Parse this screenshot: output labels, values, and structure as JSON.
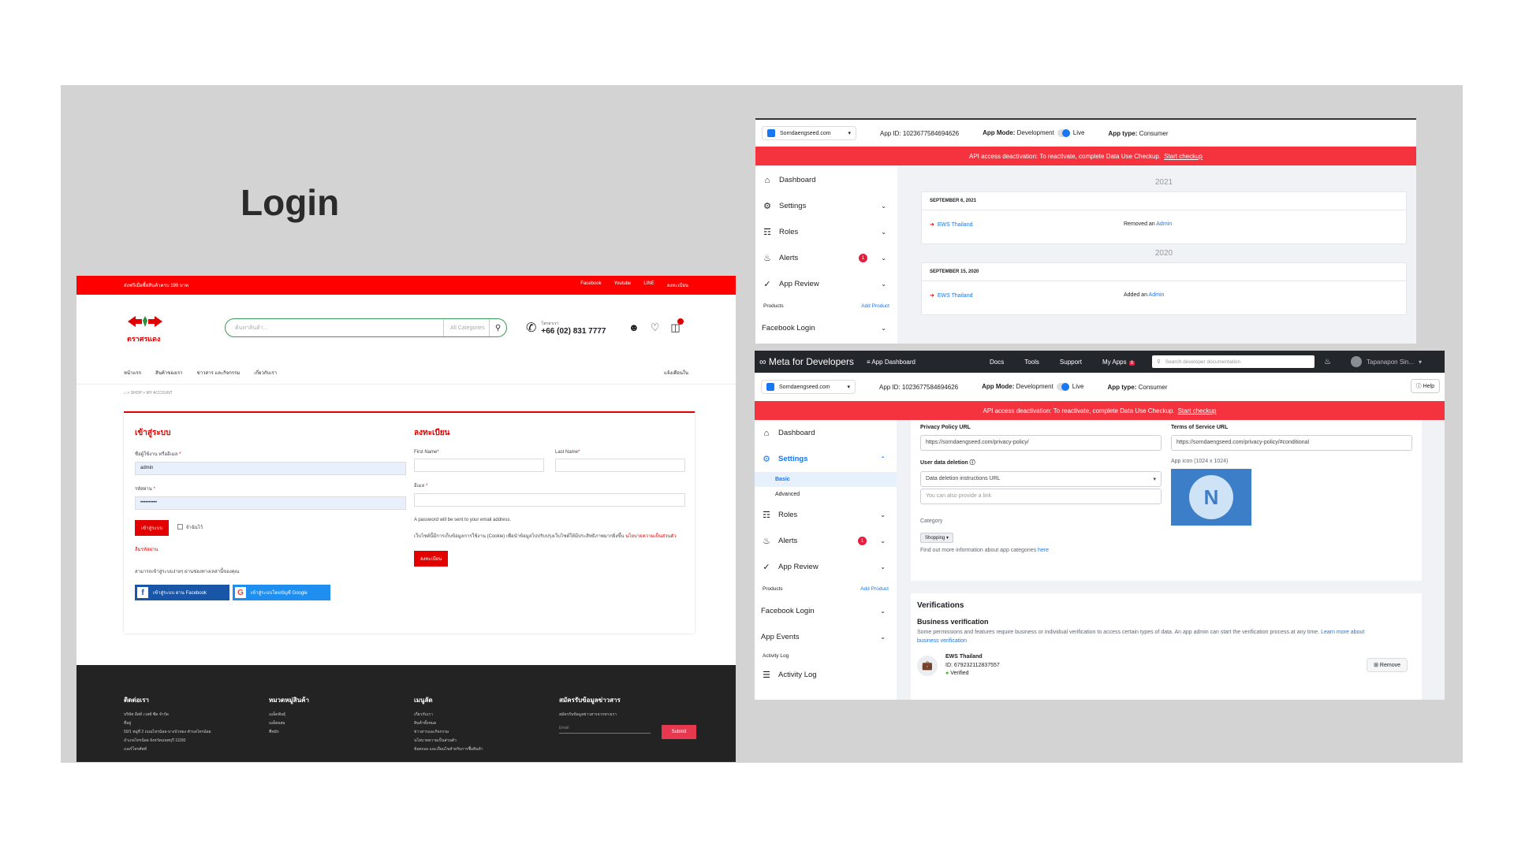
{
  "slide": {
    "title": "Login"
  },
  "shop": {
    "topbar_left": "ส่งฟรีเมื่อซื้อสินค้าครบ 199 บาท",
    "topbar_links": [
      "Facebook",
      "Youtube",
      "LINE",
      "ลงทะเบียน"
    ],
    "logo_text": "ตราศรแดง",
    "search_placeholder": "ค้นหาสินค้า...",
    "search_category": "All Categories",
    "phone_label": "โทรหาเรา",
    "phone_number": "+66 (02) 831 7777",
    "nav": [
      "หน้าแรก",
      "สินค้าของเรา",
      "ข่าวสาร และกิจกรรม",
      "เกี่ยวกับเรา"
    ],
    "nav_right": "แจ้งเตือนใน",
    "breadcrumb": "⌂  >  SHOP  >  MY ACCOUNT",
    "login": {
      "title": "เข้าสู่ระบบ",
      "user_label": "ชื่อผู้ใช้งาน หรืออีเมล",
      "user_value": "admin",
      "pass_label": "รหัสผ่าน",
      "pass_value": "••••••••••",
      "submit": "เข้าสู่ระบบ",
      "remember": "จำฉันไว้",
      "lost": "ลืมรหัสผ่าน",
      "social_note": "สามารถเข้าสู่ระบบง่ายๆ ผ่านช่องทางเหล่านี้ของคุณ",
      "facebook_btn": "เข้าสู่ระบบ ผ่าน Facebook",
      "google_btn": "เข้าสู่ระบบโดยบัญชี Google"
    },
    "register": {
      "title": "ลงทะเบียน",
      "first_name": "First Name",
      "last_name": "Last Name",
      "email": "อีเมล",
      "password_note": "A password will be sent to your email address.",
      "cookie_note": "เว็บไซต์นี้มีการเก็บข้อมูลการใช้งาน (Cookie) เพื่อนำข้อมูลไปปรับปรุงเว็บไซต์ให้มีประสิทธิภาพมากยิ่งขึ้น",
      "cookie_link": "นโยบายความเป็นส่วนตัว",
      "submit": "ลงทะเบียน"
    },
    "footer": {
      "contact_title": "ติดต่อเรา",
      "contact_lines": [
        "บริษัท อีสท์ เวสท์ ซีด จำกัด",
        "ที่อยู่",
        "50/1 หมู่ที่ 2 ถนนไทรน้อย-บางบัวทอง ตำบลไทรน้อย",
        "อำเภอไทรน้อย จังหวัดนนทบุรี 11150",
        "เบอร์โทรศัพท์"
      ],
      "cat_title": "หมวดหมู่สินค้า",
      "cat_lines": [
        "เมล็ดพันธุ์",
        "เมล็ดผสม",
        "พืชผัก"
      ],
      "menu_title": "เมนูลัด",
      "menu_lines": [
        "เกี่ยวกับเรา",
        "สินค้าทั้งหมด",
        "ข่าวสารและกิจกรรม",
        "นโยบายความเป็นส่วนตัว",
        "ข้อตกลง และเงื่อนไขสำหรับการซื้อสินค้า"
      ],
      "news_title": "สมัครรับข้อมูลข่าวสาร",
      "news_line": "สมัครรับข้อมูลข่าวสารจากทางเรา",
      "email_ph": "Email",
      "submit": "Submit"
    }
  },
  "meta1": {
    "app_name": "Sorndaengseed.com",
    "app_id": "App ID: 1023677584694626",
    "app_mode": "App Mode:",
    "app_mode_val": "Development",
    "live": "Live",
    "app_type": "App type:",
    "app_type_val": "Consumer",
    "banner": "API access deactivation: To reactivate, complete Data Use Checkup.",
    "banner_link": "Start checkup",
    "side": {
      "dashboard": "Dashboard",
      "settings": "Settings",
      "roles": "Roles",
      "alerts": "Alerts",
      "alerts_badge": "1",
      "app_review": "App Review",
      "products": "Products",
      "add_product": "Add Product",
      "facebook_login": "Facebook Login"
    },
    "log": [
      {
        "year": "2021",
        "date": "SEPTEMBER 6, 2021",
        "actor": "EWS Thailand",
        "action": "Removed an",
        "target": "Admin"
      },
      {
        "year": "2020",
        "date": "SEPTEMBER 15, 2020",
        "actor": "EWS Thailand",
        "action": "Added an",
        "target": "Admin"
      }
    ]
  },
  "meta2": {
    "brand": "∞ Meta for Developers",
    "dashboard": "≡  App Dashboard",
    "nav": [
      "Docs",
      "Tools",
      "Support",
      "My Apps"
    ],
    "myapps_badge": "9",
    "search_ph": "Search developer documentation",
    "user": "Tapanapon Sin...",
    "help": "ⓘ Help",
    "side": {
      "dashboard": "Dashboard",
      "settings": "Settings",
      "basic": "Basic",
      "advanced": "Advanced",
      "roles": "Roles",
      "alerts": "Alerts",
      "alerts_badge": "1",
      "app_review": "App Review",
      "products": "Products",
      "add_product": "Add Product",
      "facebook_login": "Facebook Login",
      "app_events": "App Events",
      "activity_log_section": "Activity Log",
      "activity_log": "Activity Log"
    },
    "form": {
      "privacy_label": "Privacy Policy URL",
      "privacy_value": "https://sorndaengseed.com/privacy-policy/",
      "tos_label": "Terms of Service URL",
      "tos_value": "https://sorndaengseed.com/privacy-policy/#conditional",
      "deletion_label": "User data deletion",
      "deletion_value": "Data deletion instructions URL",
      "deletion_ph": "You can also provide a link",
      "icon_label": "App icon (1024 x 1024)",
      "category_label": "Category",
      "category_value": "Shopping",
      "category_hint": "Find out more information about app categories",
      "category_link": "here"
    },
    "verif": {
      "title": "Verifications",
      "sub": "Business verification",
      "desc": "Some permissions and features require business or individual verification to access certain types of data. An app admin can start the verification process at any time.",
      "link": "Learn more about business verification",
      "biz_name": "EWS Thailand",
      "biz_id": "ID: 679232112837557",
      "biz_status": "Verified",
      "remove": "Remove"
    }
  }
}
